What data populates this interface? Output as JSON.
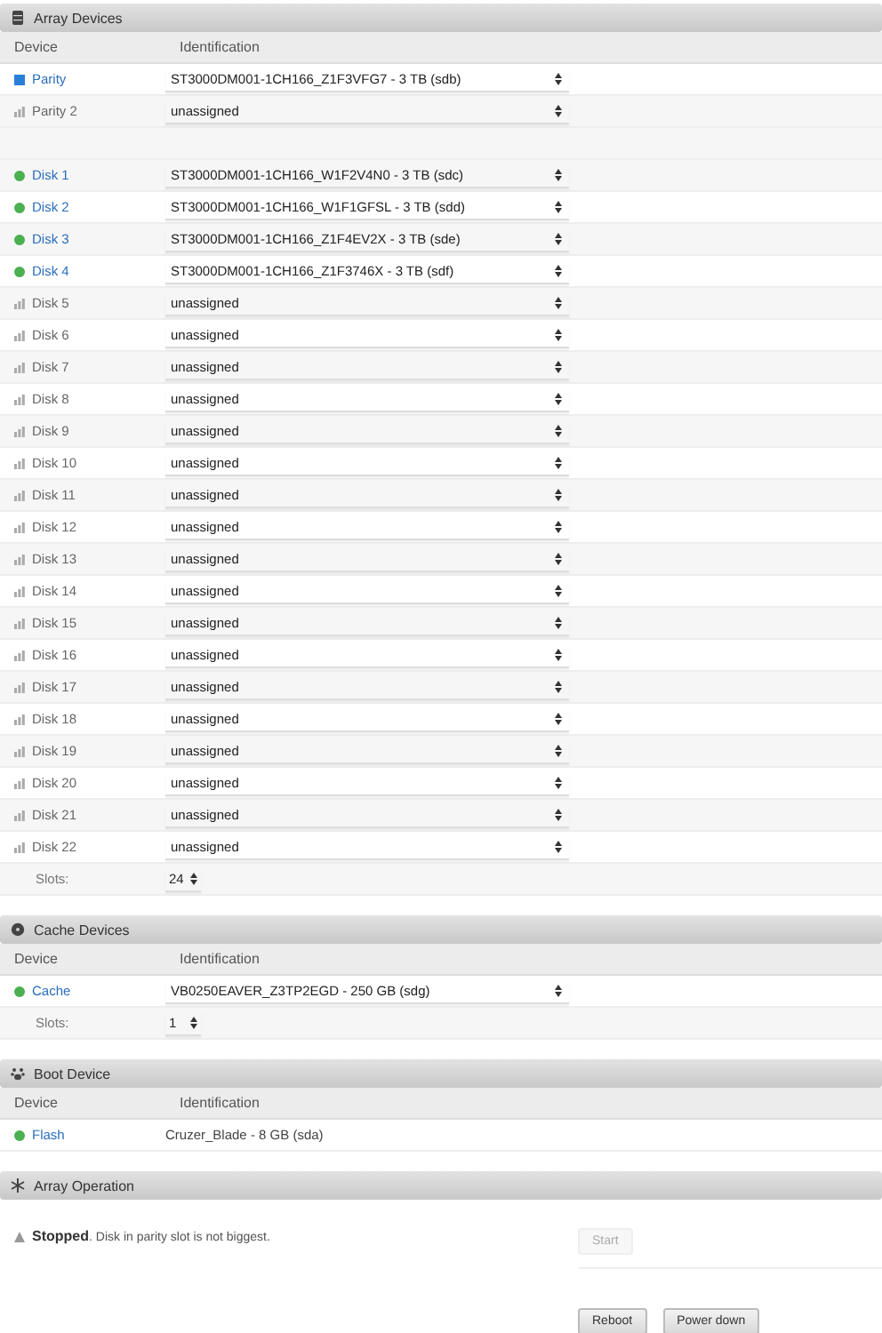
{
  "array_devices": {
    "title": "Array Devices",
    "columns": [
      "Device",
      "Identification"
    ],
    "rows": [
      {
        "kind": "parity",
        "device": "Parity",
        "identification": "ST3000DM001-1CH166_Z1F3VFG7 - 3 TB (sdb)"
      },
      {
        "kind": "unassigned",
        "device": "Parity 2",
        "identification": "unassigned"
      },
      {
        "kind": "spacer"
      },
      {
        "kind": "assigned",
        "device": "Disk 1",
        "identification": "ST3000DM001-1CH166_W1F2V4N0 - 3 TB (sdc)"
      },
      {
        "kind": "assigned",
        "device": "Disk 2",
        "identification": "ST3000DM001-1CH166_W1F1GFSL - 3 TB (sdd)"
      },
      {
        "kind": "assigned",
        "device": "Disk 3",
        "identification": "ST3000DM001-1CH166_Z1F4EV2X - 3 TB (sde)"
      },
      {
        "kind": "assigned",
        "device": "Disk 4",
        "identification": "ST3000DM001-1CH166_Z1F3746X - 3 TB (sdf)"
      },
      {
        "kind": "unassigned",
        "device": "Disk 5",
        "identification": "unassigned"
      },
      {
        "kind": "unassigned",
        "device": "Disk 6",
        "identification": "unassigned"
      },
      {
        "kind": "unassigned",
        "device": "Disk 7",
        "identification": "unassigned"
      },
      {
        "kind": "unassigned",
        "device": "Disk 8",
        "identification": "unassigned"
      },
      {
        "kind": "unassigned",
        "device": "Disk 9",
        "identification": "unassigned"
      },
      {
        "kind": "unassigned",
        "device": "Disk 10",
        "identification": "unassigned"
      },
      {
        "kind": "unassigned",
        "device": "Disk 11",
        "identification": "unassigned"
      },
      {
        "kind": "unassigned",
        "device": "Disk 12",
        "identification": "unassigned"
      },
      {
        "kind": "unassigned",
        "device": "Disk 13",
        "identification": "unassigned"
      },
      {
        "kind": "unassigned",
        "device": "Disk 14",
        "identification": "unassigned"
      },
      {
        "kind": "unassigned",
        "device": "Disk 15",
        "identification": "unassigned"
      },
      {
        "kind": "unassigned",
        "device": "Disk 16",
        "identification": "unassigned"
      },
      {
        "kind": "unassigned",
        "device": "Disk 17",
        "identification": "unassigned"
      },
      {
        "kind": "unassigned",
        "device": "Disk 18",
        "identification": "unassigned"
      },
      {
        "kind": "unassigned",
        "device": "Disk 19",
        "identification": "unassigned"
      },
      {
        "kind": "unassigned",
        "device": "Disk 20",
        "identification": "unassigned"
      },
      {
        "kind": "unassigned",
        "device": "Disk 21",
        "identification": "unassigned"
      },
      {
        "kind": "unassigned",
        "device": "Disk 22",
        "identification": "unassigned"
      },
      {
        "kind": "slots",
        "label": "Slots:",
        "value": "24"
      }
    ]
  },
  "cache_devices": {
    "title": "Cache Devices",
    "columns": [
      "Device",
      "Identification"
    ],
    "rows": [
      {
        "kind": "assigned",
        "device": "Cache",
        "identification": "VB0250EAVER_Z3TP2EGD - 250 GB (sdg)"
      },
      {
        "kind": "slots",
        "label": "Slots:",
        "value": "1"
      }
    ]
  },
  "boot_device": {
    "title": "Boot Device",
    "columns": [
      "Device",
      "Identification"
    ],
    "rows": [
      {
        "kind": "boot",
        "device": "Flash",
        "identification": "Cruzer_Blade - 8 GB (sda)"
      }
    ]
  },
  "array_operation": {
    "title": "Array Operation",
    "status_message": "**Stopped**. Disk in parity slot is not biggest.",
    "start_button": {
      "label": "Start",
      "disabled": true
    },
    "buttons": [
      "Reboot",
      "Power down"
    ]
  }
}
